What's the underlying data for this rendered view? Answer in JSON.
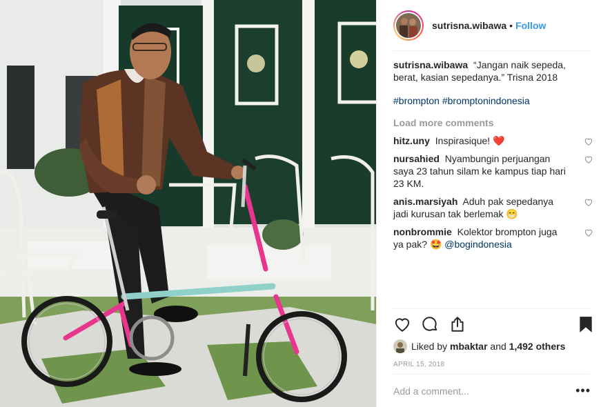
{
  "post": {
    "username": "sutrisna.wibawa",
    "separator": "•",
    "follow_label": "Follow",
    "caption_username": "sutrisna.wibawa",
    "caption_text": "“Jangan naik sepeda, berat, kasian sepedanya.” Trisna 2018",
    "hashtags": [
      "#brompton",
      "#bromptonindonesia"
    ],
    "load_more": "Load more comments"
  },
  "comments": [
    {
      "user": "hitz.uny",
      "text": "Inspirasique!",
      "emoji": "❤️"
    },
    {
      "user": "nursahied",
      "text": "Nyambungin perjuangan saya 23 tahun silam ke kampus tiap hari 23 KM."
    },
    {
      "user": "anis.marsiyah",
      "text": "Aduh pak sepedanya jadi kurusan tak berlemak",
      "emoji": "😁"
    },
    {
      "user": "nonbrommie",
      "text": "Kolektor brompton juga ya pak?",
      "emoji": "🤩",
      "mention": "@bogindonesia"
    }
  ],
  "actions": {
    "icons": [
      "heart-icon",
      "comment-icon",
      "share-icon",
      "bookmark-icon"
    ]
  },
  "likes": {
    "prefix": "Liked by",
    "user": "mbaktar",
    "joiner": "and",
    "count_text": "1,492 others"
  },
  "date": "April 15, 2018",
  "add_comment": {
    "placeholder": "Add a comment...",
    "more_label": "•••"
  },
  "colors": {
    "link_blue": "#3897f0",
    "hashtag": "#003569",
    "muted": "#999999",
    "text": "#262626",
    "bike_pink": "#e8358e",
    "bike_teal": "#8fd0c8"
  }
}
